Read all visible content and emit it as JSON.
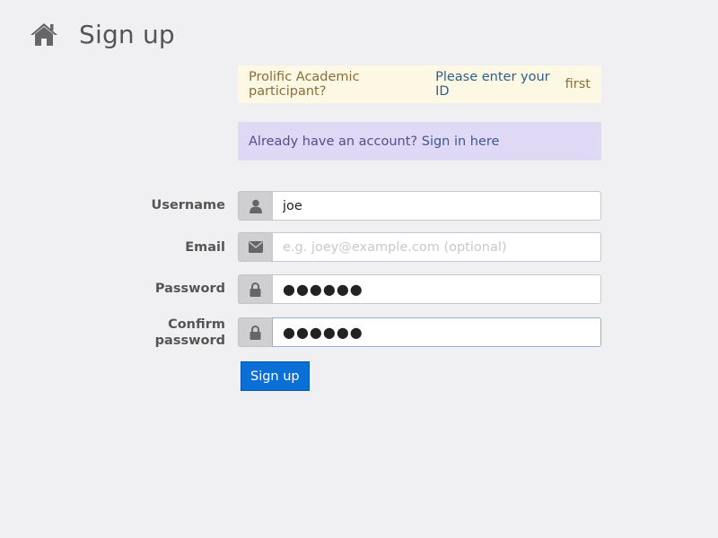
{
  "header": {
    "icon": "home-icon",
    "title": "Sign up"
  },
  "alerts": {
    "prolific": {
      "text": "Prolific Academic participant?",
      "link": "Please enter your ID",
      "suffix": "first"
    },
    "account": {
      "text": "Already have an account?",
      "link": "Sign in here"
    }
  },
  "form": {
    "username": {
      "label": "Username",
      "icon": "user-icon",
      "value": "joe",
      "placeholder": ""
    },
    "email": {
      "label": "Email",
      "icon": "envelope-icon",
      "value": "",
      "placeholder": "e.g. joey@example.com (optional)"
    },
    "password": {
      "label": "Password",
      "icon": "lock-icon",
      "value": "●●●●●●"
    },
    "confirm": {
      "label_line1": "Confirm",
      "label_line2": "password",
      "icon": "lock-icon",
      "value": "●●●●●●"
    },
    "submit_label": "Sign up"
  },
  "colors": {
    "background": "#f0f0f2",
    "primary_button": "#0a6fd6",
    "alert_warning_bg": "#fcf8e4",
    "alert_info_bg": "#e0d9f6"
  }
}
